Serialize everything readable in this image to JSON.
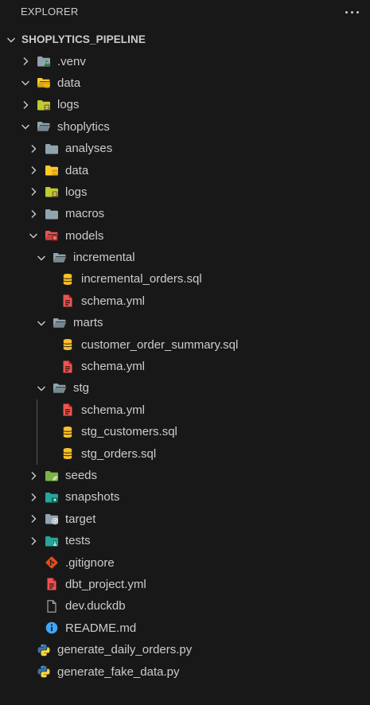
{
  "header": {
    "title": "EXPLORER",
    "more_label": "···"
  },
  "tree": [
    {
      "label": "SHOPLYTICS_PIPELINE",
      "depth": 0,
      "kind": "root",
      "expanded": true,
      "icon": "chevron-down-icon"
    },
    {
      "label": ".venv",
      "depth": 1,
      "kind": "folder",
      "expanded": false,
      "icon": "venv-folder-icon"
    },
    {
      "label": "data",
      "depth": 1,
      "kind": "folder",
      "expanded": true,
      "icon": "data-folder-open-icon"
    },
    {
      "label": "logs",
      "depth": 1,
      "kind": "folder",
      "expanded": false,
      "icon": "logs-folder-icon"
    },
    {
      "label": "shoplytics",
      "depth": 1,
      "kind": "folder",
      "expanded": true,
      "icon": "folder-open-icon"
    },
    {
      "label": "analyses",
      "depth": 2,
      "kind": "folder",
      "expanded": false,
      "icon": "folder-icon"
    },
    {
      "label": "data",
      "depth": 2,
      "kind": "folder",
      "expanded": false,
      "icon": "data-folder-icon"
    },
    {
      "label": "logs",
      "depth": 2,
      "kind": "folder",
      "expanded": false,
      "icon": "logs-folder-icon"
    },
    {
      "label": "macros",
      "depth": 2,
      "kind": "folder",
      "expanded": false,
      "icon": "folder-icon"
    },
    {
      "label": "models",
      "depth": 2,
      "kind": "folder",
      "expanded": true,
      "icon": "models-folder-open-icon"
    },
    {
      "label": "incremental",
      "depth": 3,
      "kind": "folder",
      "expanded": true,
      "icon": "folder-open-icon"
    },
    {
      "label": "incremental_orders.sql",
      "depth": 4,
      "kind": "file",
      "icon": "database-icon"
    },
    {
      "label": "schema.yml",
      "depth": 4,
      "kind": "file",
      "icon": "yaml-file-icon"
    },
    {
      "label": "marts",
      "depth": 3,
      "kind": "folder",
      "expanded": true,
      "icon": "folder-open-icon"
    },
    {
      "label": "customer_order_summary.sql",
      "depth": 4,
      "kind": "file",
      "icon": "database-icon"
    },
    {
      "label": "schema.yml",
      "depth": 4,
      "kind": "file",
      "icon": "yaml-file-icon"
    },
    {
      "label": "stg",
      "depth": 3,
      "kind": "folder",
      "expanded": true,
      "icon": "folder-open-icon"
    },
    {
      "label": "schema.yml",
      "depth": 4,
      "kind": "file",
      "icon": "yaml-file-icon"
    },
    {
      "label": "stg_customers.sql",
      "depth": 4,
      "kind": "file",
      "icon": "database-icon"
    },
    {
      "label": "stg_orders.sql",
      "depth": 4,
      "kind": "file",
      "icon": "database-icon"
    },
    {
      "label": "seeds",
      "depth": 2,
      "kind": "folder",
      "expanded": false,
      "icon": "seeds-folder-icon"
    },
    {
      "label": "snapshots",
      "depth": 2,
      "kind": "folder",
      "expanded": false,
      "icon": "snapshots-folder-icon"
    },
    {
      "label": "target",
      "depth": 2,
      "kind": "folder",
      "expanded": false,
      "icon": "target-folder-icon"
    },
    {
      "label": "tests",
      "depth": 2,
      "kind": "folder",
      "expanded": false,
      "icon": "tests-folder-icon"
    },
    {
      "label": ".gitignore",
      "depth": 2,
      "kind": "file",
      "icon": "git-icon"
    },
    {
      "label": "dbt_project.yml",
      "depth": 2,
      "kind": "file",
      "icon": "yaml-file-icon"
    },
    {
      "label": "dev.duckdb",
      "depth": 2,
      "kind": "file",
      "icon": "file-icon"
    },
    {
      "label": "README.md",
      "depth": 2,
      "kind": "file",
      "icon": "info-icon"
    },
    {
      "label": "generate_daily_orders.py",
      "depth": 1,
      "kind": "file",
      "icon": "python-icon"
    },
    {
      "label": "generate_fake_data.py",
      "depth": 1,
      "kind": "file",
      "icon": "python-icon"
    }
  ],
  "colors": {
    "background": "#181818",
    "text": "#cccccc",
    "folder_gray": "#90a4ae",
    "folder_yellow": "#ffca28",
    "folder_olive": "#c0ca33",
    "folder_red": "#ef5350",
    "folder_green": "#7cb342",
    "folder_teal": "#26a69a",
    "yaml_red": "#ef5350",
    "db_yellow": "#fbc02d",
    "git_orange": "#e64a19",
    "info_blue": "#42a5f5",
    "python_blue": "#3776ab",
    "python_yellow": "#ffd43b"
  }
}
